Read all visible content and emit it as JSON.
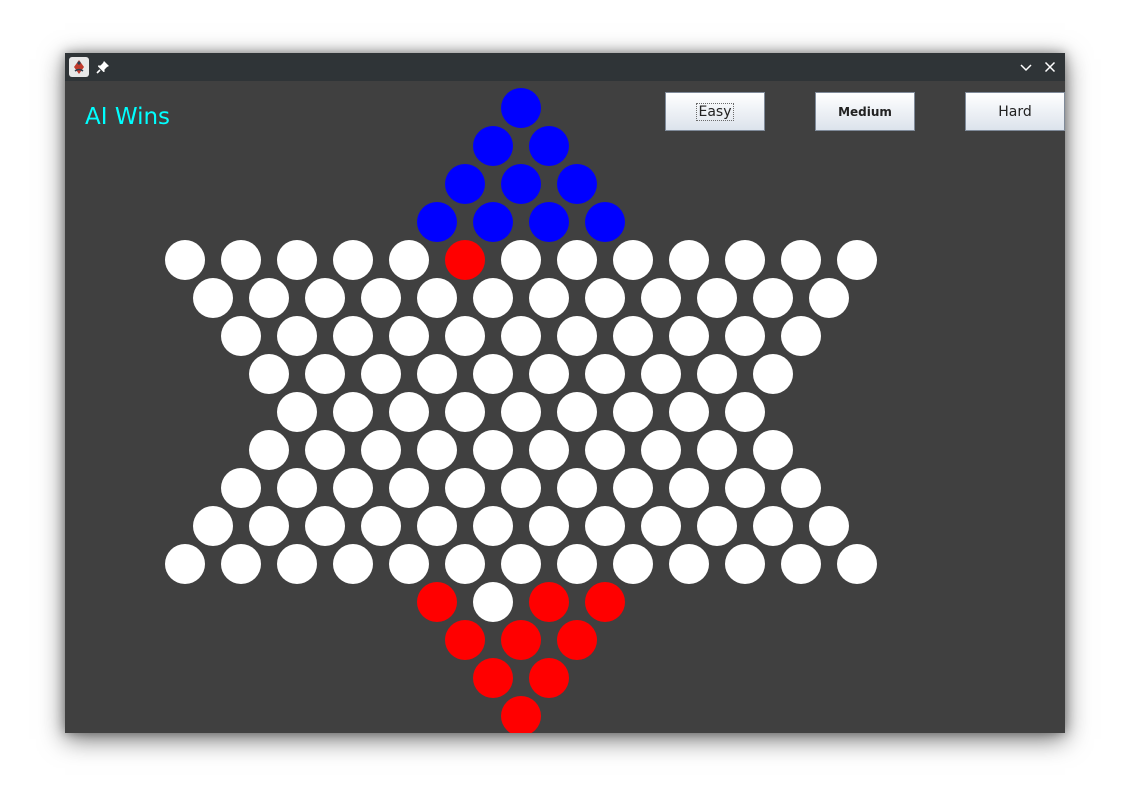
{
  "window": {
    "title": "",
    "background": "#404040"
  },
  "status": {
    "text": "AI Wins",
    "color": "#00ffff"
  },
  "buttons": {
    "easy_label": "Easy",
    "medium_label": "Medium",
    "hard_label": "Hard"
  },
  "colors": {
    "empty": "#ffffff",
    "ai": "#0000ff",
    "player": "#ff0000",
    "board": "#404040"
  },
  "board": {
    "rows": [
      {
        "offset": 12,
        "cells": [
          "B"
        ]
      },
      {
        "offset": 11,
        "cells": [
          "B",
          "B"
        ]
      },
      {
        "offset": 10,
        "cells": [
          "B",
          "B",
          "B"
        ]
      },
      {
        "offset": 9,
        "cells": [
          "B",
          "B",
          "B",
          "B"
        ]
      },
      {
        "offset": 0,
        "cells": [
          "E",
          "E",
          "E",
          "E",
          "E",
          "R",
          "E",
          "E",
          "E",
          "E",
          "E",
          "E",
          "E"
        ]
      },
      {
        "offset": 1,
        "cells": [
          "E",
          "E",
          "E",
          "E",
          "E",
          "E",
          "E",
          "E",
          "E",
          "E",
          "E",
          "E"
        ]
      },
      {
        "offset": 2,
        "cells": [
          "E",
          "E",
          "E",
          "E",
          "E",
          "E",
          "E",
          "E",
          "E",
          "E",
          "E"
        ]
      },
      {
        "offset": 3,
        "cells": [
          "E",
          "E",
          "E",
          "E",
          "E",
          "E",
          "E",
          "E",
          "E",
          "E"
        ]
      },
      {
        "offset": 4,
        "cells": [
          "E",
          "E",
          "E",
          "E",
          "E",
          "E",
          "E",
          "E",
          "E"
        ]
      },
      {
        "offset": 3,
        "cells": [
          "E",
          "E",
          "E",
          "E",
          "E",
          "E",
          "E",
          "E",
          "E",
          "E"
        ]
      },
      {
        "offset": 2,
        "cells": [
          "E",
          "E",
          "E",
          "E",
          "E",
          "E",
          "E",
          "E",
          "E",
          "E",
          "E"
        ]
      },
      {
        "offset": 1,
        "cells": [
          "E",
          "E",
          "E",
          "E",
          "E",
          "E",
          "E",
          "E",
          "E",
          "E",
          "E",
          "E"
        ]
      },
      {
        "offset": 0,
        "cells": [
          "E",
          "E",
          "E",
          "E",
          "E",
          "E",
          "E",
          "E",
          "E",
          "E",
          "E",
          "E",
          "E"
        ]
      },
      {
        "offset": 9,
        "cells": [
          "R",
          "E",
          "R",
          "R"
        ]
      },
      {
        "offset": 10,
        "cells": [
          "R",
          "R",
          "R"
        ]
      },
      {
        "offset": 11,
        "cells": [
          "R",
          "R"
        ]
      },
      {
        "offset": 12,
        "cells": [
          "R"
        ]
      }
    ]
  }
}
